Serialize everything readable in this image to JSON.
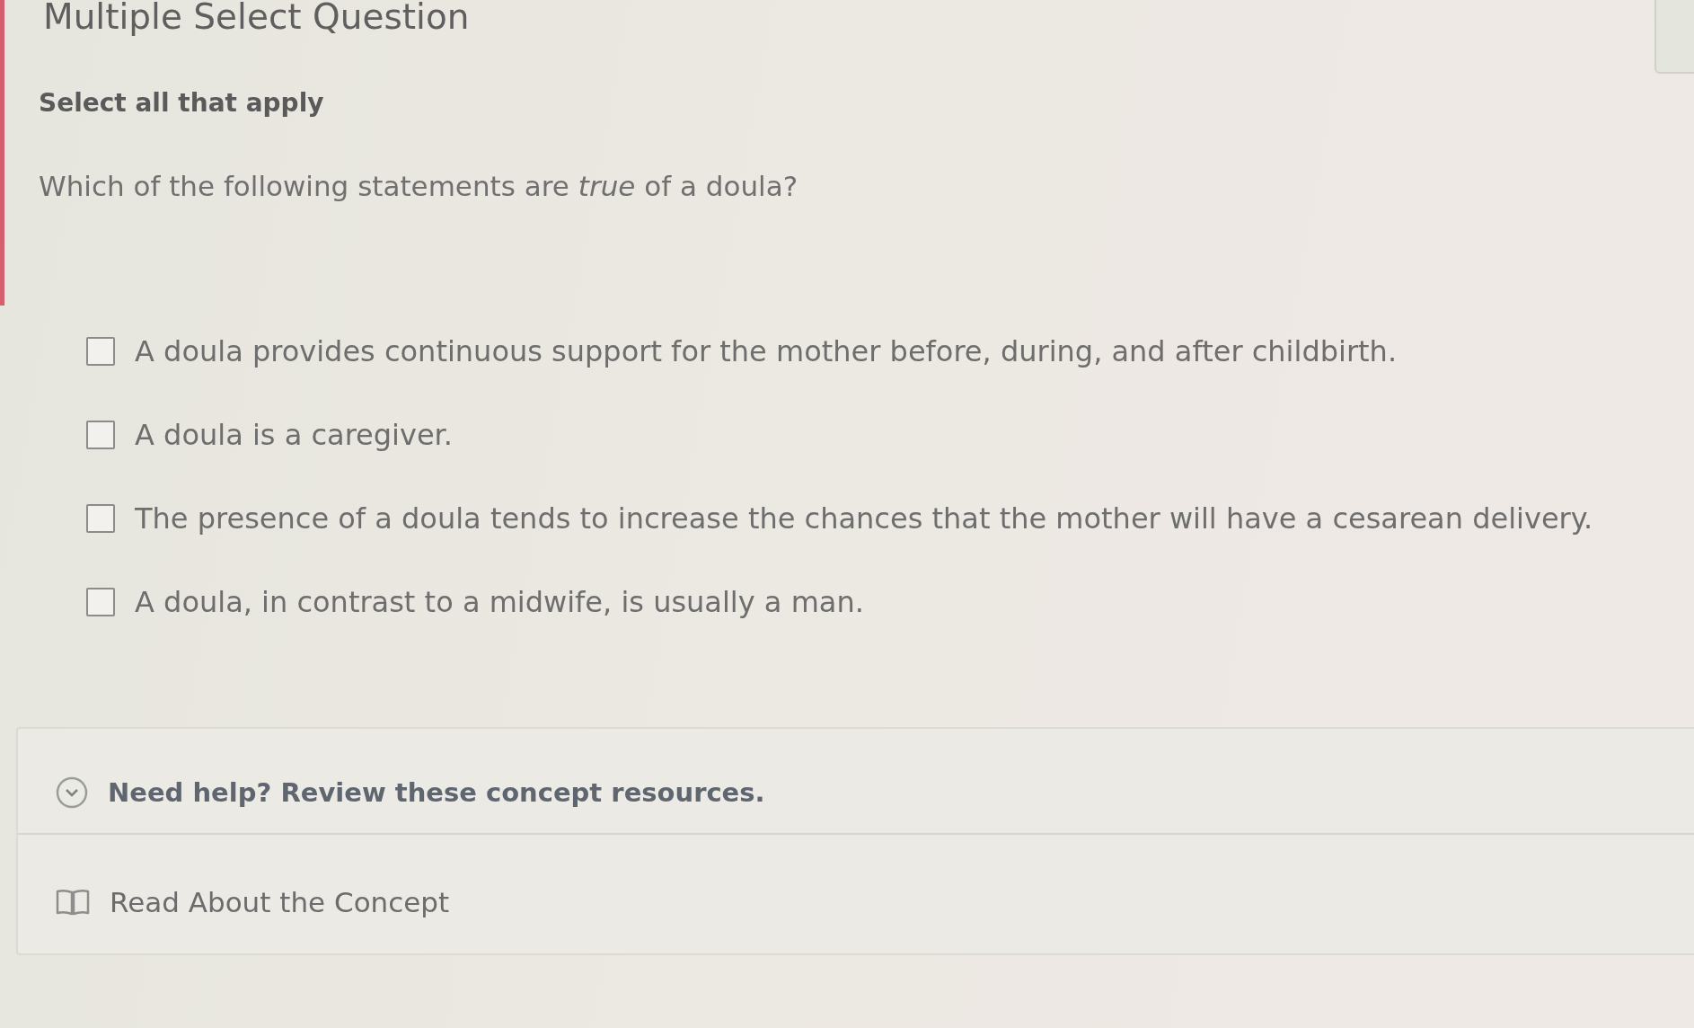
{
  "header": {
    "title": "Multiple Select Question"
  },
  "instruction": "Select all that apply",
  "question": "Which of the following statements are *true* of a doula?",
  "options": [
    {
      "text": "A doula provides continuous support for the mother before, during, and after childbirth.",
      "checked": false
    },
    {
      "text": "A doula is a caregiver.",
      "checked": false
    },
    {
      "text": "The presence of a doula tends to increase the chances that the mother will have a cesarean delivery.",
      "checked": false
    },
    {
      "text": "A doula, in contrast to a midwife, is usually a man.",
      "checked": false
    }
  ],
  "help": {
    "title": "Need help? Review these concept resources.",
    "expanded": true,
    "resources": [
      {
        "label": "Read About the Concept"
      }
    ]
  }
}
